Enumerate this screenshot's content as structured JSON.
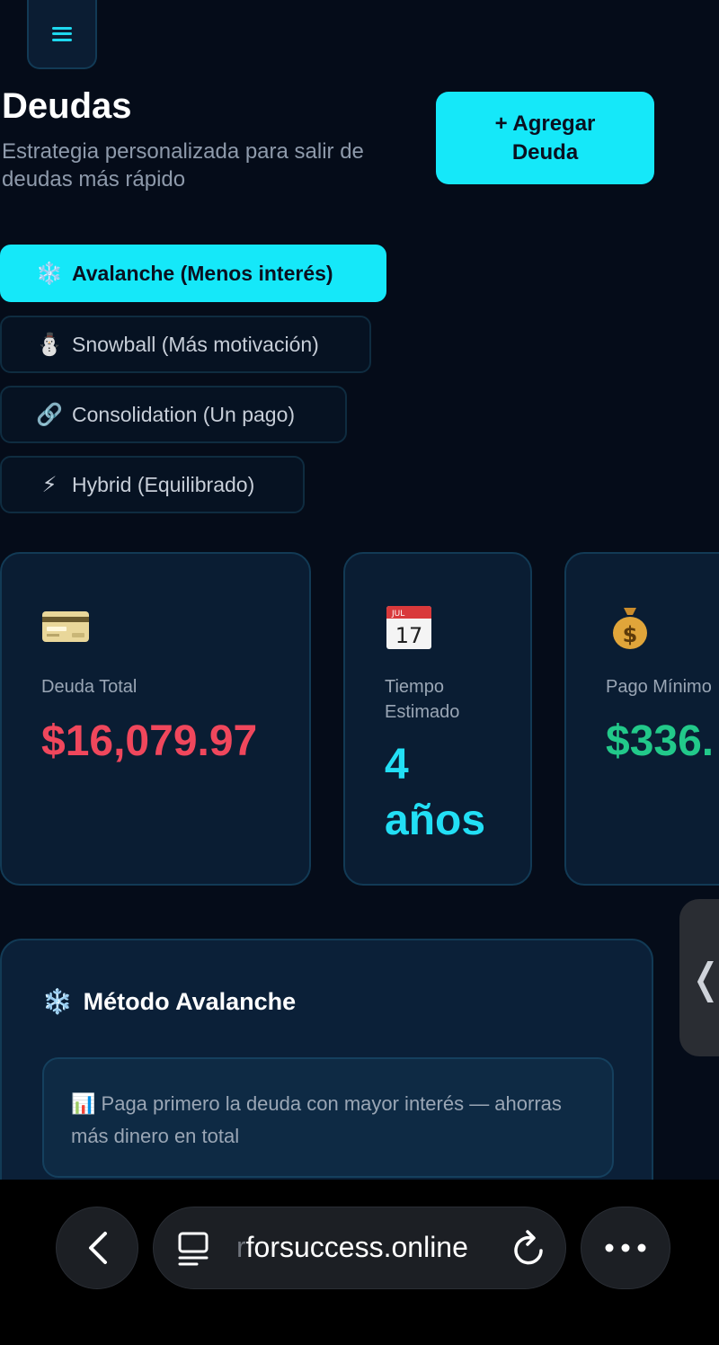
{
  "header": {
    "title": "Deudas",
    "subtitle": "Estrategia personalizada para salir de deudas más rápido",
    "add_button": "+ Agregar Deuda"
  },
  "strategies": [
    {
      "icon": "snowflake-icon",
      "glyph": "❄️",
      "label": "Avalanche (Menos interés)",
      "active": true
    },
    {
      "icon": "snowman-icon",
      "glyph": "⛄",
      "label": "Snowball (Más motivación)",
      "active": false
    },
    {
      "icon": "link-icon",
      "glyph": "🔗",
      "label": "Consolidation (Un pago)",
      "active": false
    },
    {
      "icon": "lightning-icon",
      "glyph": "⚡",
      "label": "Hybrid (Equilibrado)",
      "active": false
    }
  ],
  "stats": {
    "total_debt": {
      "icon": "credit-card-icon",
      "label": "Deuda Total",
      "value": "$16,079.97",
      "color": "#f0475c"
    },
    "estimated_time": {
      "icon": "calendar-icon",
      "label": "Tiempo Estimado",
      "value_line1": "4",
      "value_line2": "años",
      "calendar_month": "JUL",
      "calendar_day": "17",
      "color": "#22dff5"
    },
    "minimum_payment": {
      "icon": "money-bag-icon",
      "label": "Pago Mínimo",
      "value": "$336.",
      "color": "#22c98a"
    }
  },
  "method": {
    "icon": "snowflake-icon",
    "title": "Método Avalanche",
    "note_icon": "bar-chart-icon",
    "note": "Paga primero la deuda con mayor interés — ahorras más dinero en total"
  },
  "browser": {
    "url_faded": "r",
    "url": "forsuccess.online"
  }
}
